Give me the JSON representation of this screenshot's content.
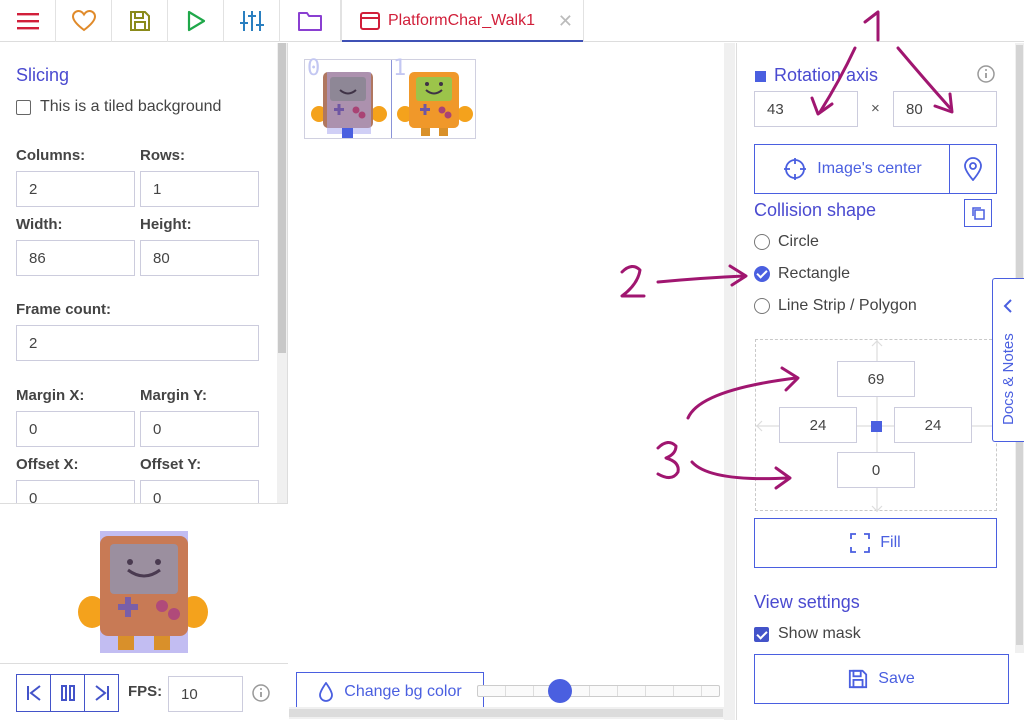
{
  "toolbar": {
    "buttons": [
      "menu-icon",
      "heart-icon",
      "save-icon",
      "play-icon",
      "sliders-icon",
      "folder-icon"
    ],
    "tab": {
      "label": "PlatformChar_Walk1",
      "icon": "texture-icon",
      "close": "✕"
    }
  },
  "slicing": {
    "title": "Slicing",
    "tiled_label": "This is a tiled background",
    "tiled_checked": false,
    "columns_label": "Columns:",
    "columns": "2",
    "rows_label": "Rows:",
    "rows": "1",
    "width_label": "Width:",
    "width": "86",
    "height_label": "Height:",
    "height": "80",
    "frame_count_label": "Frame count:",
    "frame_count": "2",
    "margin_x_label": "Margin X:",
    "margin_x": "0",
    "margin_y_label": "Margin Y:",
    "margin_y": "0",
    "offset_x_label": "Offset X:",
    "offset_x": "0",
    "offset_y_label": "Offset Y:",
    "offset_y": "0"
  },
  "player": {
    "fps_label": "FPS:",
    "fps": "10"
  },
  "canvas": {
    "frames": [
      "0",
      "1"
    ],
    "bg_button": "Change bg color",
    "zoom_level": 0.33
  },
  "rotation": {
    "title": "Rotation axis",
    "x": "43",
    "sep": "×",
    "y": "80",
    "center_button": "Image's center"
  },
  "collision": {
    "title": "Collision shape",
    "options": [
      "Circle",
      "Rectangle",
      "Line Strip / Polygon"
    ],
    "selected": "Rectangle",
    "top": "69",
    "left": "24",
    "right": "24",
    "bottom": "0",
    "fill_button": "Fill"
  },
  "view": {
    "title": "View settings",
    "show_mask_label": "Show mask",
    "show_mask": true,
    "save_button": "Save"
  },
  "docs_tab": "Docs & Notes",
  "annotations": [
    "1",
    "2",
    "3"
  ],
  "colors": {
    "accent": "#4a5fe0",
    "tab_text": "#d11f3a",
    "annotation": "#a01670"
  }
}
